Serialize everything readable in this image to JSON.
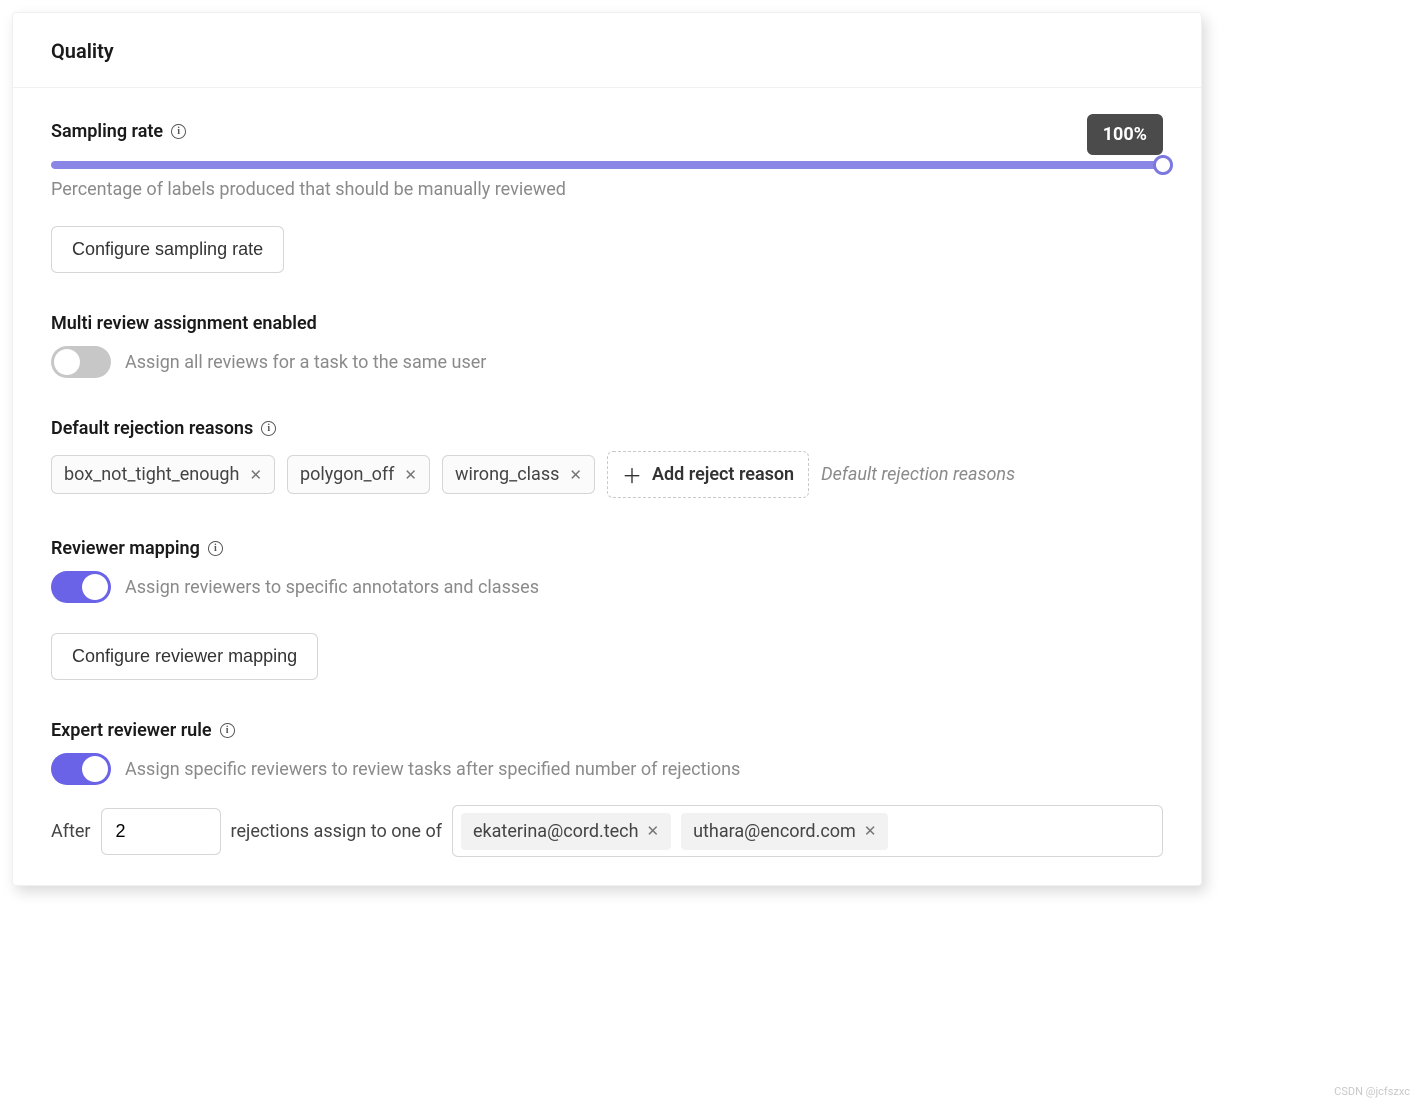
{
  "panel_title": "Quality",
  "sampling": {
    "label": "Sampling rate",
    "value_badge": "100%",
    "help": "Percentage of labels produced that should be manually reviewed",
    "configure_button": "Configure sampling rate"
  },
  "multi_review": {
    "label": "Multi review assignment enabled",
    "enabled": false,
    "description": "Assign all reviews for a task to the same user"
  },
  "rejection": {
    "label": "Default rejection reasons",
    "tags": [
      "box_not_tight_enough",
      "polygon_off",
      "wirong_class"
    ],
    "add_label": "Add reject reason",
    "hint": "Default rejection reasons"
  },
  "reviewer_mapping": {
    "label": "Reviewer mapping",
    "enabled": true,
    "description": "Assign reviewers to specific annotators and classes",
    "configure_button": "Configure reviewer mapping"
  },
  "expert_rule": {
    "label": "Expert reviewer rule",
    "enabled": true,
    "description": "Assign specific reviewers to review tasks after specified number of rejections",
    "prefix": "After",
    "count": "2",
    "middle": "rejections assign to one of",
    "assignees": [
      "ekaterina@cord.tech",
      "uthara@encord.com"
    ]
  },
  "watermark": "CSDN @jcfszxc"
}
